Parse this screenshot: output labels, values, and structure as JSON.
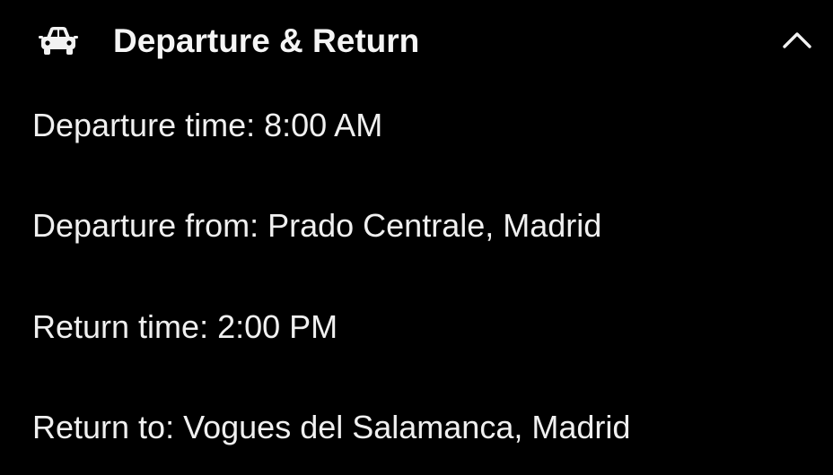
{
  "section": {
    "title": "Departure & Return",
    "icon": "car-icon",
    "toggle_icon": "chevron-up-icon",
    "expanded": true
  },
  "details": [
    "Departure time: 8:00 AM",
    "Departure from: Prado Centrale, Madrid",
    "Return time: 2:00 PM",
    "Return to: Vogues del Salamanca, Madrid"
  ],
  "colors": {
    "background": "#000000",
    "text": "#f2f2f2"
  }
}
